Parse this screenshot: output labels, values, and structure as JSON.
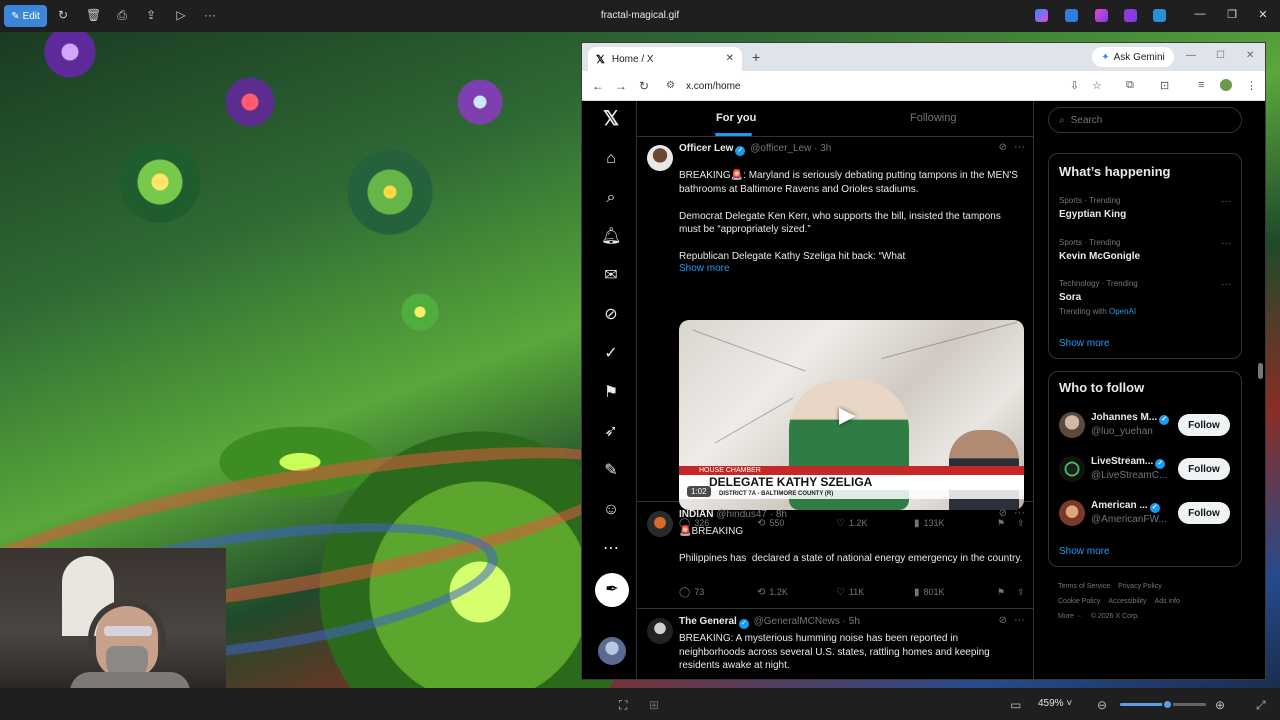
{
  "viewer": {
    "edit_label": "Edit",
    "file_title": "fractal-magical.gif",
    "zoom": "459%",
    "zoom_level": 0.55
  },
  "browser": {
    "tab_title": "Home / X",
    "gemini_label": "Ask Gemini",
    "url": "x.com/home"
  },
  "timeline": {
    "tabs": [
      "For you",
      "Following"
    ],
    "tweets": [
      {
        "name": "Officer Lew",
        "handle": "@officer_Lew",
        "time": "· 3h",
        "text": "BREAKING🚨: Maryland is seriously debating putting tampons in the MEN'S bathrooms at Baltimore Ravens and Orioles stadiums.\n\nDemocrat Delegate Ken Kerr, who supports the bill, insisted the tampons must be “appropriately sized.”\n\nRepublican Delegate Kathy Szeliga hit back: “What",
        "show_more": "Show more",
        "media": {
          "top_banner": "HOUSE CHAMBER",
          "headline": "DELEGATE KATHY SZELIGA",
          "subline": "DISTRICT 7A - BALTIMORE COUNTY (R)",
          "duration": "1:02"
        },
        "replies": "326",
        "reposts": "550",
        "likes": "1.2K",
        "views": "131K"
      },
      {
        "name": "INDIAN",
        "handle": "@hindus47",
        "time": "· 8h",
        "text": "🚨BREAKING\n\nPhilippines has  declared a state of national energy emergency in the country.",
        "replies": "73",
        "reposts": "1.2K",
        "likes": "11K",
        "views": "801K"
      },
      {
        "name": "The General",
        "handle": "@GeneralMCNews",
        "time": "· 5h",
        "text": "BREAKING: A mysterious humming noise has been reported in neighborhoods across several U.S. states, rattling homes and keeping residents awake at night."
      }
    ]
  },
  "sidebar": {
    "search_placeholder": "Search",
    "whats_happening": "What’s happening",
    "trends": [
      {
        "meta": "Sports · Trending",
        "name": "Egyptian King"
      },
      {
        "meta": "Sports · Trending",
        "name": "Kevin McGonigle"
      },
      {
        "meta": "Technology · Trending",
        "name": "Sora",
        "with_prefix": "Trending with",
        "with": "OpenAI"
      }
    ],
    "show_more": "Show more",
    "who_to_follow": "Who to follow",
    "follow_suggestions": [
      {
        "name": "Johannes M...",
        "handle": "@luo_yuehan",
        "button": "Follow"
      },
      {
        "name": "LiveStream...",
        "handle": "@LiveStreamC...",
        "button": "Follow"
      },
      {
        "name": "American ...",
        "handle": "@AmericanFW...",
        "button": "Follow"
      }
    ],
    "footer": [
      "Terms of Service",
      "Privacy Policy",
      "Cookie Policy",
      "Accessibility",
      "Ads info",
      "More ···",
      "© 2026 X Corp."
    ]
  },
  "colors": {
    "accent": "#1d9bf0",
    "edit_button": "#3b86d8"
  }
}
